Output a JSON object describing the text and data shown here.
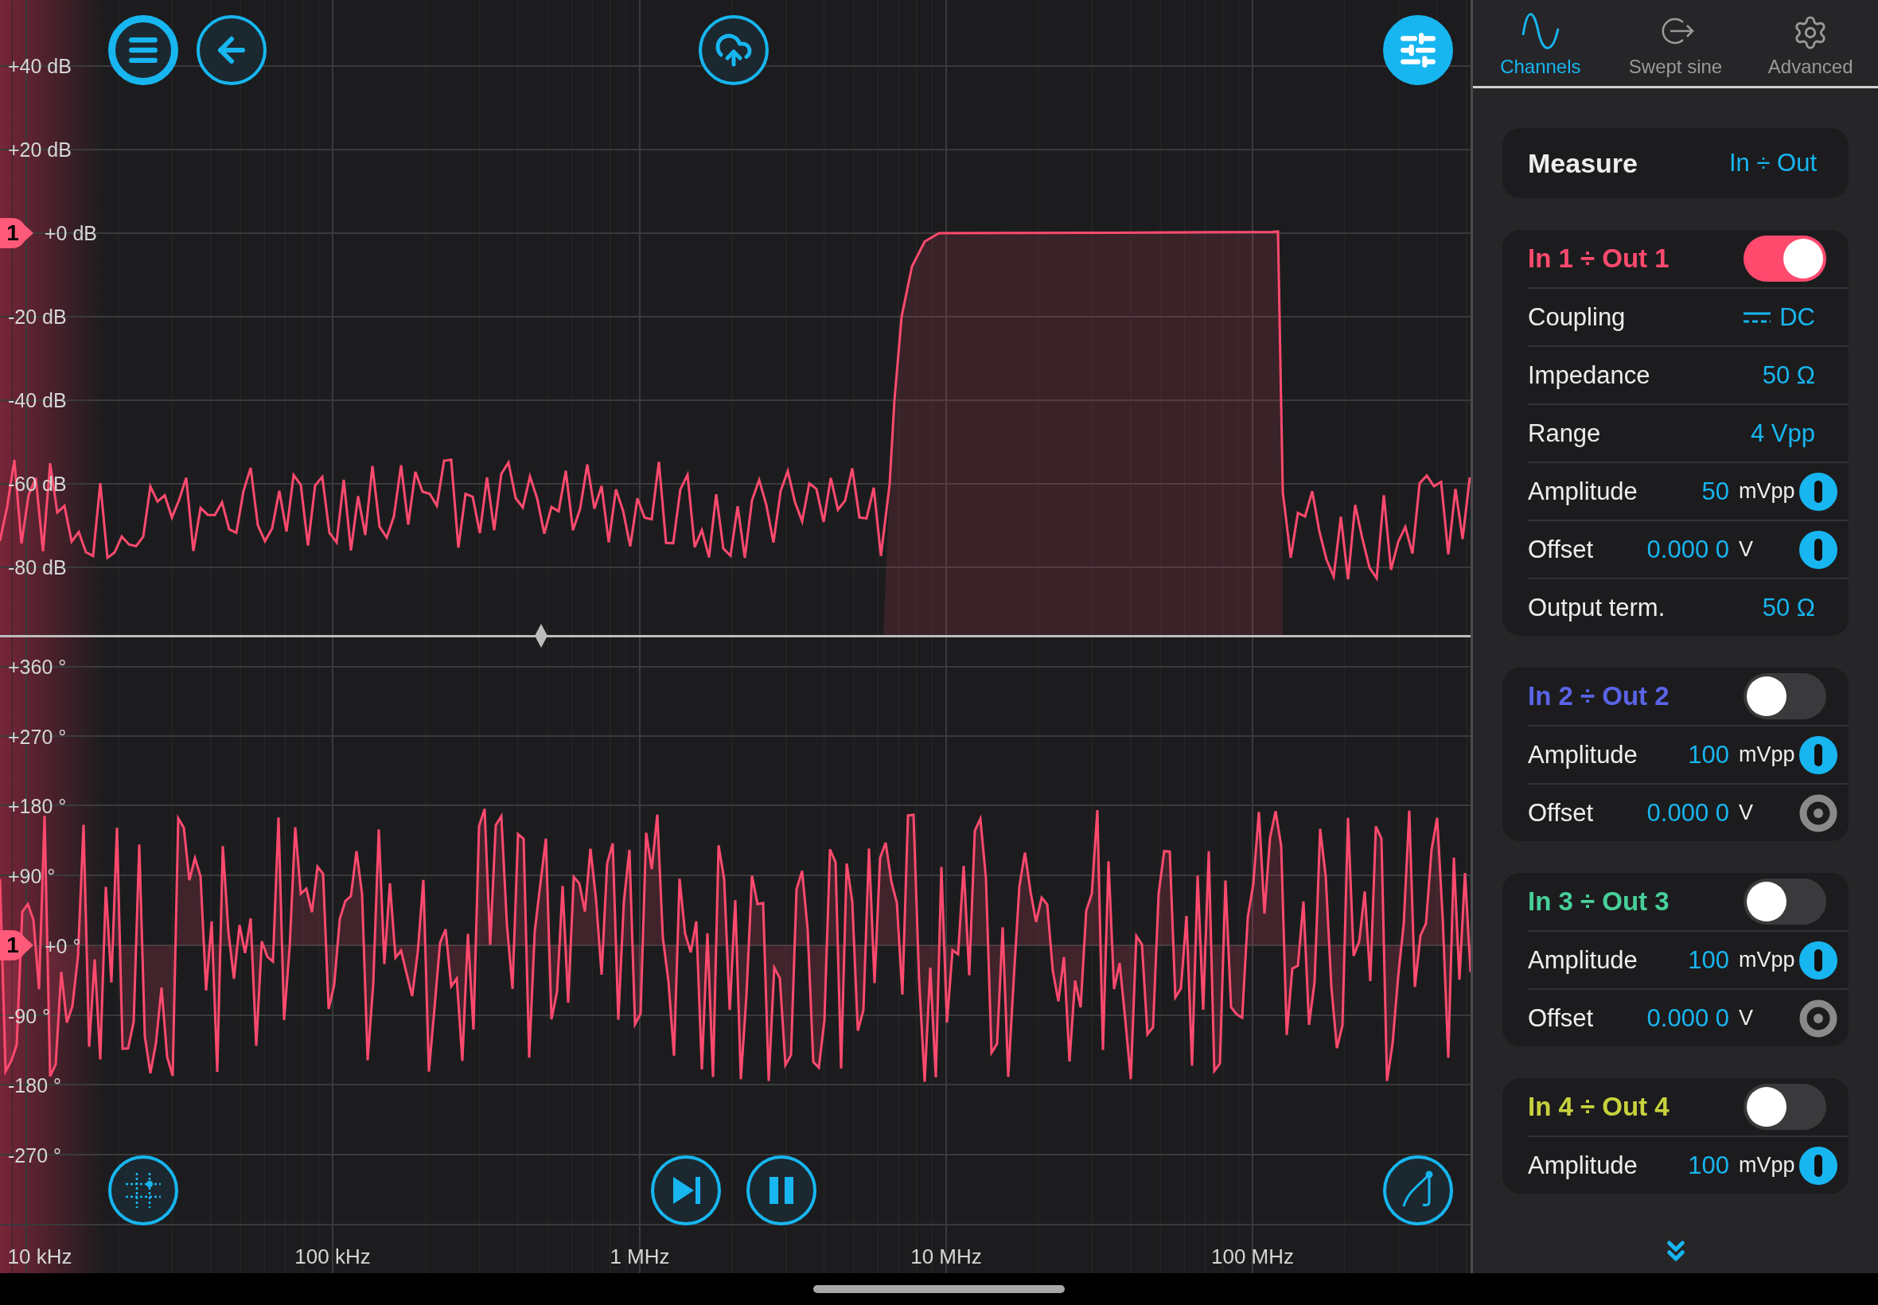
{
  "magnitude_plot": {
    "y_ticks": [
      "+40 dB",
      "+20 dB",
      "+0 dB",
      "-20 dB",
      "-40 dB",
      "-60 dB",
      "-80 dB"
    ],
    "marker": "1"
  },
  "phase_plot": {
    "y_ticks": [
      "+360 °",
      "+270 °",
      "+180 °",
      "+90 °",
      "+0 °",
      "-90 °",
      "-180 °",
      "-270 °"
    ],
    "marker": "1"
  },
  "x_axis": {
    "labels": [
      "10 kHz",
      "100 kHz",
      "1 MHz",
      "10 MHz",
      "100 MHz"
    ]
  },
  "side_panel": {
    "tabs": [
      {
        "label": "Channels",
        "kind": "wave",
        "selected": true
      },
      {
        "label": "Swept sine",
        "kind": "export",
        "selected": false
      },
      {
        "label": "Advanced",
        "kind": "gear",
        "selected": false
      }
    ],
    "measure": {
      "label": "Measure",
      "value": "In ÷ Out"
    },
    "channels": [
      {
        "title": "In 1 ÷ Out 1",
        "color": "#ff4a6e",
        "on": true,
        "rows": [
          {
            "kind": "coupling",
            "label": "Coupling",
            "value": "DC"
          },
          {
            "kind": "plain",
            "label": "Impedance",
            "value": "50 Ω"
          },
          {
            "kind": "plain",
            "label": "Range",
            "value": "4 Vpp"
          },
          {
            "kind": "knob",
            "label": "Amplitude",
            "value": "50",
            "unit": "mVpp",
            "active": true
          },
          {
            "kind": "knob",
            "label": "Offset",
            "value": "0.000 0",
            "unit": "V",
            "active": true
          },
          {
            "kind": "plain",
            "label": "Output term.",
            "value": "50 Ω"
          }
        ]
      },
      {
        "title": "In 2 ÷ Out 2",
        "color": "#5a64e6",
        "on": false,
        "rows": [
          {
            "kind": "knob",
            "label": "Amplitude",
            "value": "100",
            "unit": "mVpp",
            "active": true
          },
          {
            "kind": "knob",
            "label": "Offset",
            "value": "0.000 0",
            "unit": "V",
            "active": false
          }
        ]
      },
      {
        "title": "In 3 ÷ Out 3",
        "color": "#48d09a",
        "on": false,
        "rows": [
          {
            "kind": "knob",
            "label": "Amplitude",
            "value": "100",
            "unit": "mVpp",
            "active": true
          },
          {
            "kind": "knob",
            "label": "Offset",
            "value": "0.000 0",
            "unit": "V",
            "active": false
          }
        ]
      },
      {
        "title": "In 4 ÷ Out 4",
        "color": "#c8d23c",
        "on": false,
        "rows": [
          {
            "kind": "knob",
            "label": "Amplitude",
            "value": "100",
            "unit": "mVpp",
            "active": true
          }
        ]
      }
    ]
  }
}
